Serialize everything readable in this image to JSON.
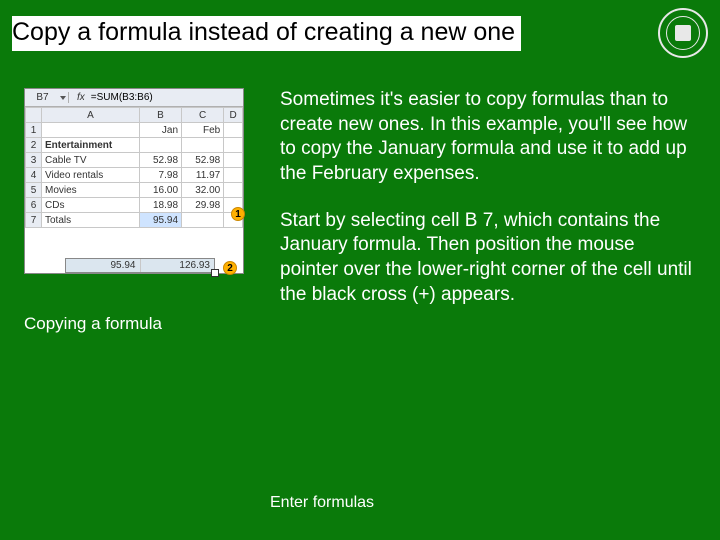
{
  "title": "Copy a formula instead of creating a new one",
  "caption": "Copying a formula",
  "para1": "Sometimes it's easier to copy formulas than to create new ones. In this example, you'll see how to copy the January formula and use it to add up the February expenses.",
  "para2": "Start by selecting cell B 7, which contains the January formula. Then position the mouse pointer over the lower-right corner of the cell until the black cross (+) appears.",
  "footer": "Enter formulas",
  "sheet": {
    "namebox": "B7",
    "fx": "fx",
    "formula": "=SUM(B3:B6)",
    "cols": [
      "",
      "A",
      "B",
      "C",
      "D"
    ],
    "rows": [
      {
        "n": "1",
        "a": "",
        "b": "Jan",
        "c": "Feb",
        "d": ""
      },
      {
        "n": "2",
        "a": "Entertainment",
        "b": "",
        "c": "",
        "d": ""
      },
      {
        "n": "3",
        "a": "Cable TV",
        "b": "52.98",
        "c": "52.98",
        "d": ""
      },
      {
        "n": "4",
        "a": "Video rentals",
        "b": "7.98",
        "c": "11.97",
        "d": ""
      },
      {
        "n": "5",
        "a": "Movies",
        "b": "16.00",
        "c": "32.00",
        "d": ""
      },
      {
        "n": "6",
        "a": "CDs",
        "b": "18.98",
        "c": "29.98",
        "d": ""
      },
      {
        "n": "7",
        "a": "Totals",
        "b": "95.94",
        "c": "",
        "d": ""
      }
    ],
    "fill": {
      "v1": "95.94",
      "v2": "126.93"
    },
    "markers": {
      "m1": "1",
      "m2": "2"
    }
  }
}
